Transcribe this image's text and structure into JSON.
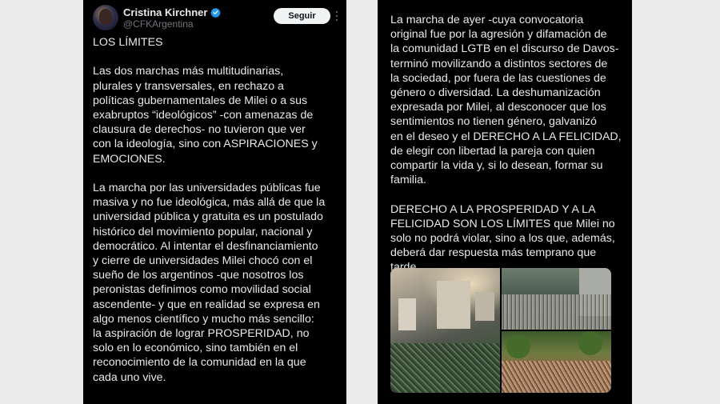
{
  "author": {
    "display_name": "Cristina Kirchner",
    "handle": "@CFKArgentina",
    "verified": true
  },
  "actions": {
    "follow_label": "Seguir",
    "more_icon": "more-vertical-icon"
  },
  "colors": {
    "background": "#000000",
    "text": "#e7e9ea",
    "secondary_text": "#71767b",
    "verified": "#1d9bf0",
    "follow_button_bg": "#eff3f4"
  },
  "left_post": {
    "title": "LOS LÍMITES",
    "paragraph_1": [
      "Las dos marchas más multitudinarias,",
      "plurales y transversales, en rechazo a",
      "políticas gubernamentales de Milei o a sus",
      "exabruptos “ideológicos” -con amenazas de",
      "clausura de derechos- no tuvieron que ver",
      "con la ideología, sino con ASPIRACIONES y",
      "EMOCIONES."
    ],
    "paragraph_2": [
      "La marcha por las universidades públicas fue",
      "masiva y no fue ideológica, más allá de que la",
      "universidad pública y gratuita es un postulado",
      "histórico del movimiento popular, nacional y",
      "democrático. Al intentar el desfinanciamiento",
      "y cierre de universidades Milei chocó con el",
      "sueño de los argentinos -que nosotros los",
      "peronistas definimos como movilidad social",
      "ascendente- y que en realidad se expresa en",
      "algo menos científico y mucho más sencillo:",
      "la aspiración de lograr PROSPERIDAD, no",
      "solo en lo económico, sino también en el",
      "reconocimiento de la comunidad en la que",
      "cada uno vive."
    ]
  },
  "right_post": {
    "paragraph_1": [
      "La marcha de ayer -cuya convocatoria",
      "original fue por la agresión y difamación de",
      "la comunidad LGTB en el discurso de Davos-",
      "terminó movilizando a distintos sectores de",
      "la sociedad, por fuera de las cuestiones de",
      "género o diversidad. La deshumanización",
      "expresada por Milei, al desconocer que los",
      "sentimientos no tienen género, galvanizó",
      "en el deseo y el DERECHO A LA FELICIDAD,",
      "de elegir con libertad la pareja con quien",
      "compartir la vida y, si lo desean, formar su",
      "familia."
    ],
    "paragraph_2": [
      "DERECHO A LA PROSPERIDAD Y A LA",
      "FELICIDAD SON LOS LÍMITES que Milei no",
      "solo no podrá violar, sino a los que, además,",
      "deberá dar respuesta más temprano que",
      "tarde."
    ]
  }
}
